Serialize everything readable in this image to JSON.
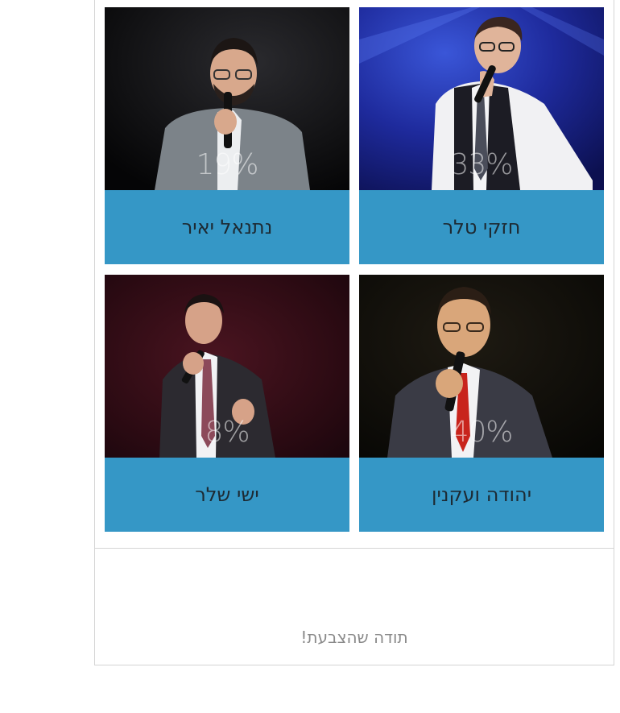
{
  "poll": {
    "candidates": [
      {
        "name": "חזקי טלר",
        "percent": "33%",
        "percent_value": 33
      },
      {
        "name": "נתנאל יאיר",
        "percent": "19%",
        "percent_value": 19
      },
      {
        "name": "יהודה ועקנין",
        "percent": "40%",
        "percent_value": 40
      },
      {
        "name": "ישי שלר",
        "percent": "8%",
        "percent_value": 8
      }
    ],
    "thanks_message": "תודה שהצבעת!"
  },
  "colors": {
    "name_bar": "#3597c6",
    "name_text": "#1d2a33",
    "border": "#d4d4d4",
    "thanks_text": "#8a8a8a"
  }
}
